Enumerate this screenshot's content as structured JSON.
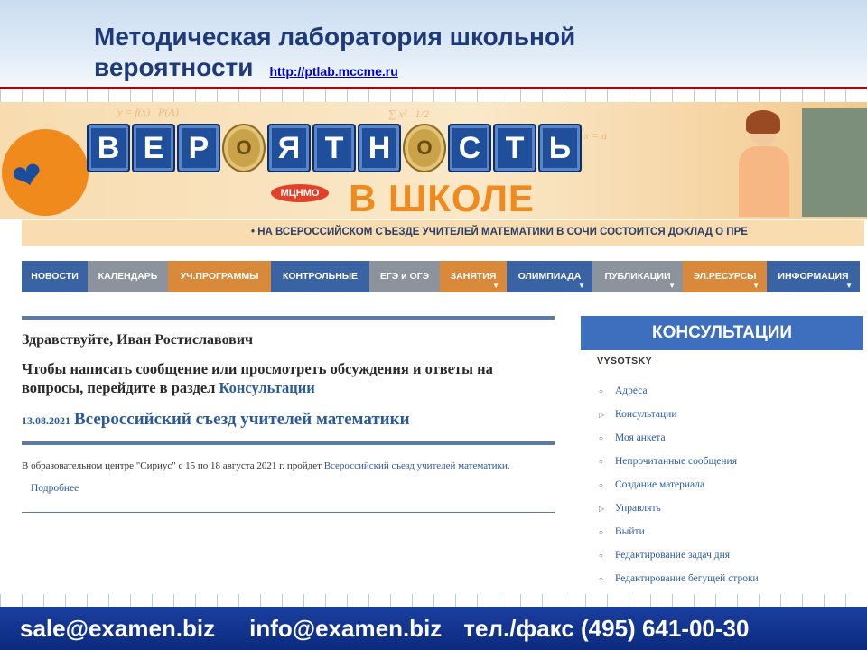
{
  "slide": {
    "title_line1": "Методическая лаборатория школьной",
    "title_line2": "вероятности",
    "link": "http://ptlab.mccme.ru"
  },
  "banner": {
    "letters": [
      "В",
      "Е",
      "Р",
      "О",
      "Я",
      "Т",
      "Н",
      "О",
      "С",
      "Т",
      "Ь"
    ],
    "subtitle": "В ШКОЛЕ",
    "publisher": "МЦНМО"
  },
  "ticker": {
    "text": "• НА ВСЕРОССИЙСКОМ СЪЕЗДЕ УЧИТЕЛЕЙ МАТЕМАТИКИ В СОЧИ СОСТОИТСЯ ДОКЛАД О ПРЕ"
  },
  "menu": {
    "items": [
      {
        "label": "НОВОСТИ",
        "color": "#3a63a4",
        "dropdown": false
      },
      {
        "label": "КАЛЕНДАРЬ",
        "color": "#8d939c",
        "dropdown": false
      },
      {
        "label": "УЧ.ПРОГРАММЫ",
        "color": "#d8893a",
        "dropdown": false
      },
      {
        "label": "КОНТРОЛЬНЫЕ",
        "color": "#3a63a4",
        "dropdown": false
      },
      {
        "label": "ЕГЭ и ОГЭ",
        "color": "#8d939c",
        "dropdown": false
      },
      {
        "label": "ЗАНЯТИЯ",
        "color": "#d8893a",
        "dropdown": true
      },
      {
        "label": "ОЛИМПИАДА",
        "color": "#3a63a4",
        "dropdown": true
      },
      {
        "label": "ПУБЛИКАЦИИ",
        "color": "#8d939c",
        "dropdown": true
      },
      {
        "label": "ЭЛ.РЕСУРСЫ",
        "color": "#d8893a",
        "dropdown": true
      },
      {
        "label": "ИНФОРМАЦИЯ",
        "color": "#3a63a4",
        "dropdown": true
      }
    ]
  },
  "main": {
    "greeting": "Здравствуйте, Иван Ростиславович",
    "message_prefix": "Чтобы написать сообщение или просмотреть обсуждения и ответы на вопросы, перейдите в раздел ",
    "message_link": "Консультации",
    "news": {
      "date": "13.08.2021",
      "title": "Всероссийский съезд учителей математики",
      "body_prefix": "В образовательном центре \"Сириус\" с 15 по 18 августа 2021 г. пройдет ",
      "body_link": "Всероссийский съезд учителей математики",
      "body_suffix": ".",
      "more": "Подробнее"
    }
  },
  "sidebar": {
    "title": "КОНСУЛЬТАЦИИ",
    "user": "VYSOTSKY",
    "items": [
      {
        "label": "Адреса",
        "bullet": "○"
      },
      {
        "label": "Консультации",
        "bullet": "▷"
      },
      {
        "label": "Моя анкета",
        "bullet": "○"
      },
      {
        "label": "Непрочитанные сообщения",
        "bullet": "○"
      },
      {
        "label": "Создание материала",
        "bullet": "○"
      },
      {
        "label": "Управлять",
        "bullet": "▷"
      },
      {
        "label": "Выйти",
        "bullet": "○"
      },
      {
        "label": "Редактирование задач дня",
        "bullet": "○"
      },
      {
        "label": "Редактирование бегущей строки",
        "bullet": "○"
      }
    ]
  },
  "footer": {
    "email1": "sale@examen.biz",
    "email2": "info@examen.biz",
    "phone": "тел./факс (495) 641-00-30"
  }
}
